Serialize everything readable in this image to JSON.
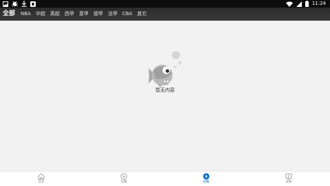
{
  "status_bar": {
    "time": "11:24",
    "icons": [
      "image-icon",
      "bug-icon",
      "download-icon",
      "app-badge-icon",
      "wifi-icon",
      "signal-icon",
      "battery-icon"
    ]
  },
  "categories": {
    "active_index": 0,
    "items": [
      "全部",
      "NBA",
      "中超",
      "英超",
      "西甲",
      "意甲",
      "德甲",
      "法甲",
      "CBA",
      "其它"
    ]
  },
  "empty_state": {
    "message": "暂无内容",
    "icon": "empty-fish-icon"
  },
  "bottom_nav": {
    "active_index": 2,
    "items": [
      {
        "label": "首页",
        "icon": "home-icon"
      },
      {
        "label": "比赛",
        "icon": "play-circle-icon"
      },
      {
        "label": "回看",
        "icon": "replay-icon"
      },
      {
        "label": "视频",
        "icon": "video-icon"
      }
    ]
  },
  "colors": {
    "status_bar_bg": "#0c0c0c",
    "category_bar_bg": "#333333",
    "content_bg": "#f2f2f2",
    "nav_active": "#1a73c8",
    "nav_inactive": "#8a8a8a"
  }
}
